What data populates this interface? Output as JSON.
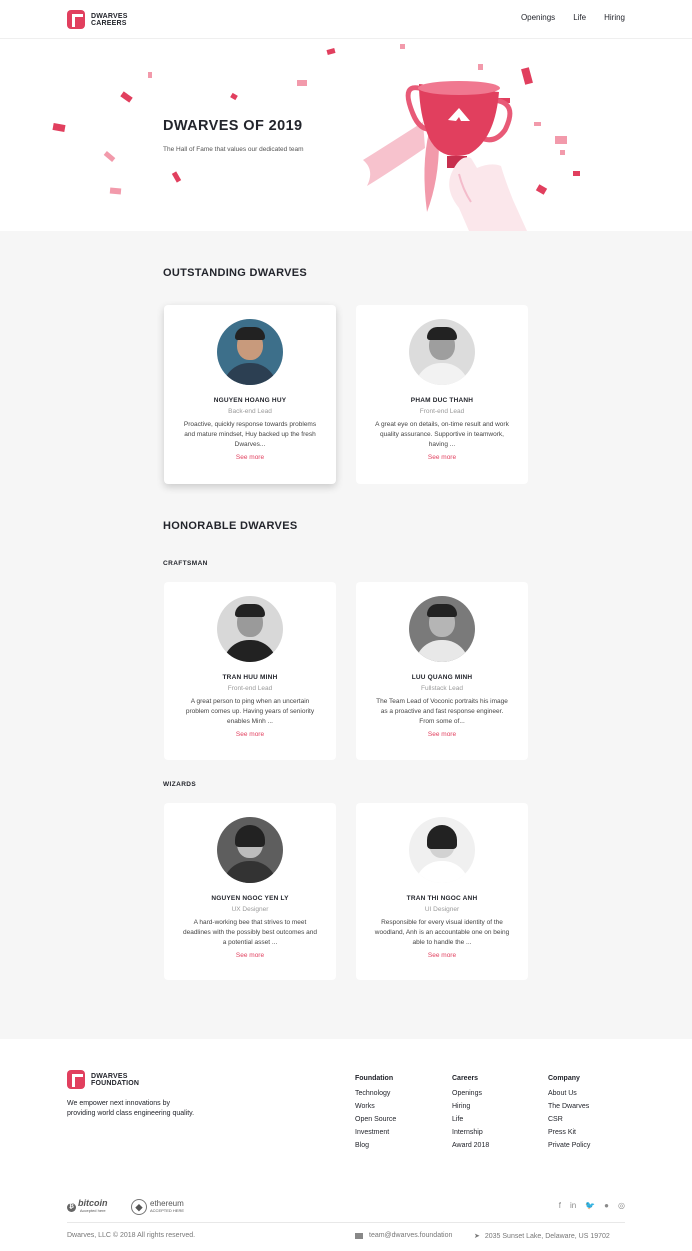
{
  "header": {
    "logo_line1": "DWARVES",
    "logo_line2": "CAREERS",
    "nav": [
      "Openings",
      "Life",
      "Hiring"
    ]
  },
  "hero": {
    "title": "DWARVES OF 2019",
    "subtitle": "The Hall of Fame that values our dedicated team"
  },
  "outstanding": {
    "title": "OUTSTANDING DWARVES",
    "cards": [
      {
        "name": "NGUYEN HOANG HUY",
        "role": "Back-end Lead",
        "desc": "Proactive, quickly response towards problems and mature mindset, Huy backed up the fresh Dwarves...",
        "more": "See more"
      },
      {
        "name": "PHAM DUC THANH",
        "role": "Front-end Lead",
        "desc": "A great eye on details, on-time result and work quality assurance. Supportive in teamwork, having ...",
        "more": "See more"
      }
    ]
  },
  "honorable": {
    "title": "HONORABLE DWARVES",
    "craftsman": {
      "label": "CRAFTSMAN",
      "cards": [
        {
          "name": "TRAN HUU MINH",
          "role": "Front-end Lead",
          "desc": "A great person to ping when an uncertain problem comes up. Having years of seniority enables Minh ...",
          "more": "See more"
        },
        {
          "name": "LUU QUANG MINH",
          "role": "Fullstack Lead",
          "desc": "The Team Lead of Voconic portraits his image as a proactive and fast response engineer. From some of...",
          "more": "See more"
        }
      ]
    },
    "wizards": {
      "label": "WIZARDS",
      "cards": [
        {
          "name": "NGUYEN NGOC YEN LY",
          "role": "UX Designer",
          "desc": "A hard-working bee that strives to meet deadlines with the possibly best outcomes and a potential asset ...",
          "more": "See more"
        },
        {
          "name": "TRAN THI NGOC ANH",
          "role": "UI Designer",
          "desc": "Responsible for every visual identity of the woodland, Anh is an accountable one on being able to handle the ...",
          "more": "See more"
        }
      ]
    }
  },
  "footer": {
    "logo_line1": "DWARVES",
    "logo_line2": "FOUNDATION",
    "tagline": "We empower next innovations by providing world class engineering quality.",
    "columns": [
      {
        "heading": "Foundation",
        "items": [
          "Technology",
          "Works",
          "Open Source",
          "Investment",
          "Blog"
        ]
      },
      {
        "heading": "Careers",
        "items": [
          "Openings",
          "Hiring",
          "Life",
          "Internship",
          "Award 2018"
        ]
      },
      {
        "heading": "Company",
        "items": [
          "About Us",
          "The Dwarves",
          "CSR",
          "Press Kit",
          "Private Policy"
        ]
      }
    ],
    "bitcoin": "bitcoin",
    "bitcoin_sub": "Accepted here",
    "ethereum": "ethereum",
    "ethereum_sub": "ACCEPTED HERE",
    "copyright": "Dwarves, LLC ©  2018 All rights reserved.",
    "email": "team@dwarves.foundation",
    "address": "2035 Sunset Lake, Delaware, US 19702"
  },
  "colors": {
    "accent": "#e13f5e",
    "background": "#f6f6f6"
  }
}
